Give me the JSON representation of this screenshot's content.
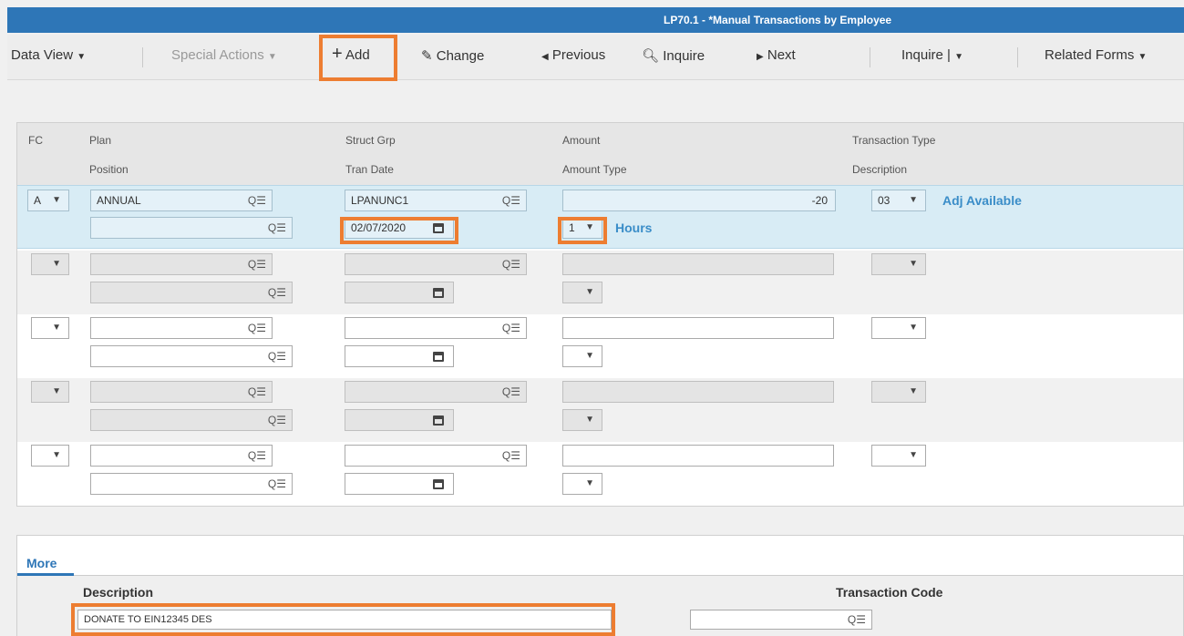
{
  "window": {
    "title": "LP70.1 - *Manual Transactions by Employee"
  },
  "toolbar": {
    "data_view": "Data View",
    "special_actions": "Special Actions",
    "add": "Add",
    "change": "Change",
    "previous": "Previous",
    "inquire": "Inquire",
    "next": "Next",
    "inquire2": "Inquire",
    "related_forms": "Related Forms"
  },
  "grid": {
    "headers": {
      "fc": "FC",
      "plan": "Plan",
      "position": "Position",
      "struct_grp": "Struct Grp",
      "tran_date": "Tran Date",
      "amount": "Amount",
      "amount_type": "Amount Type",
      "transaction_type": "Transaction Type",
      "description": "Description"
    },
    "rows": [
      {
        "fc": "A",
        "plan": "ANNUAL",
        "position": "",
        "struct_grp": "LPANUNC1",
        "tran_date": "02/07/2020",
        "amount": "-20",
        "amount_type": "1",
        "amount_type_desc": "Hours",
        "transaction_type": "03",
        "transaction_desc": "Adj Available"
      },
      {
        "fc": "",
        "plan": "",
        "position": "",
        "struct_grp": "",
        "tran_date": "",
        "amount": "",
        "amount_type": "",
        "amount_type_desc": "",
        "transaction_type": "",
        "transaction_desc": ""
      },
      {
        "fc": "",
        "plan": "",
        "position": "",
        "struct_grp": "",
        "tran_date": "",
        "amount": "",
        "amount_type": "",
        "amount_type_desc": "",
        "transaction_type": "",
        "transaction_desc": ""
      },
      {
        "fc": "",
        "plan": "",
        "position": "",
        "struct_grp": "",
        "tran_date": "",
        "amount": "",
        "amount_type": "",
        "amount_type_desc": "",
        "transaction_type": "",
        "transaction_desc": ""
      },
      {
        "fc": "",
        "plan": "",
        "position": "",
        "struct_grp": "",
        "tran_date": "",
        "amount": "",
        "amount_type": "",
        "amount_type_desc": "",
        "transaction_type": "",
        "transaction_desc": ""
      }
    ]
  },
  "more": {
    "tab": "More",
    "description_label": "Description",
    "description_value": "DONATE TO EIN12345 DES",
    "transaction_code_label": "Transaction Code",
    "transaction_code_value": ""
  },
  "icons": {
    "lookup": "search-list-icon",
    "calendar": "calendar-icon",
    "dropdown": "chevron-down-icon"
  },
  "colors": {
    "titlebar": "#2e76b7",
    "highlight": "#ed7d31",
    "link": "#3a8dc8",
    "selected_row": "#d8ecf5"
  }
}
